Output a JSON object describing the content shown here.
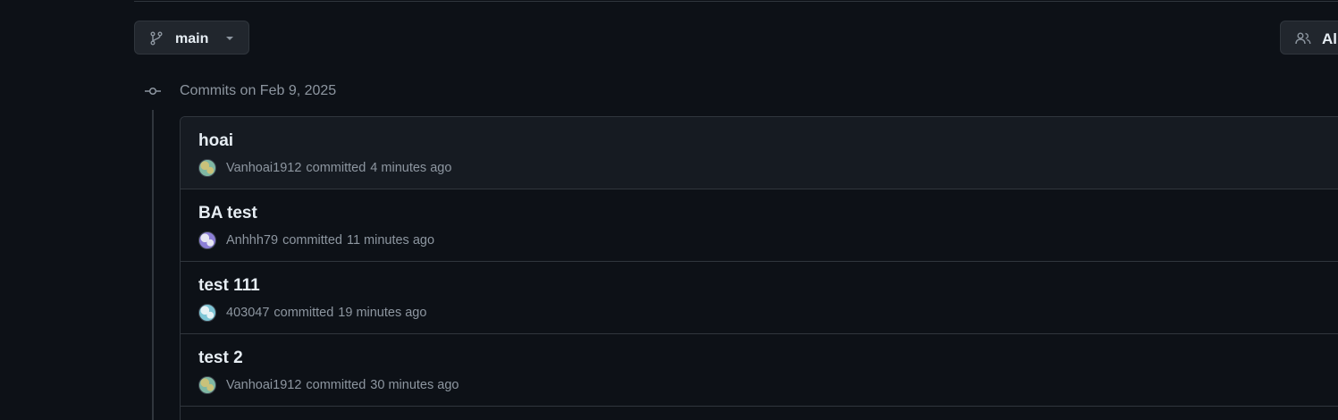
{
  "branch_selector": {
    "label": "main",
    "icon": "git-branch-icon"
  },
  "users_filter": {
    "label": "All",
    "icon": "people-icon"
  },
  "commit_group": {
    "heading": "Commits on Feb 9, 2025",
    "icon": "git-commit-icon"
  },
  "commits": [
    {
      "title": "hoai",
      "author": "Vanhoai1912",
      "verb": "committed",
      "time": "4 minutes ago",
      "avatar_colors": [
        "#7fb8a4",
        "#c9c27a"
      ]
    },
    {
      "title": "BA test",
      "author": "Anhhh79",
      "verb": "committed",
      "time": "11 minutes ago",
      "avatar_colors": [
        "#8c7fd6",
        "#e6e6f2"
      ]
    },
    {
      "title": "test 111",
      "author": "403047",
      "verb": "committed",
      "time": "19 minutes ago",
      "avatar_colors": [
        "#7fc6d6",
        "#e6f2f5"
      ]
    },
    {
      "title": "test 2",
      "author": "Vanhoai1912",
      "verb": "committed",
      "time": "30 minutes ago",
      "avatar_colors": [
        "#7fb8a4",
        "#c9c27a"
      ]
    }
  ],
  "colors": {
    "background": "#0d1117",
    "border": "#30363d",
    "text_primary": "#e6edf3",
    "text_muted": "#8d96a0"
  }
}
